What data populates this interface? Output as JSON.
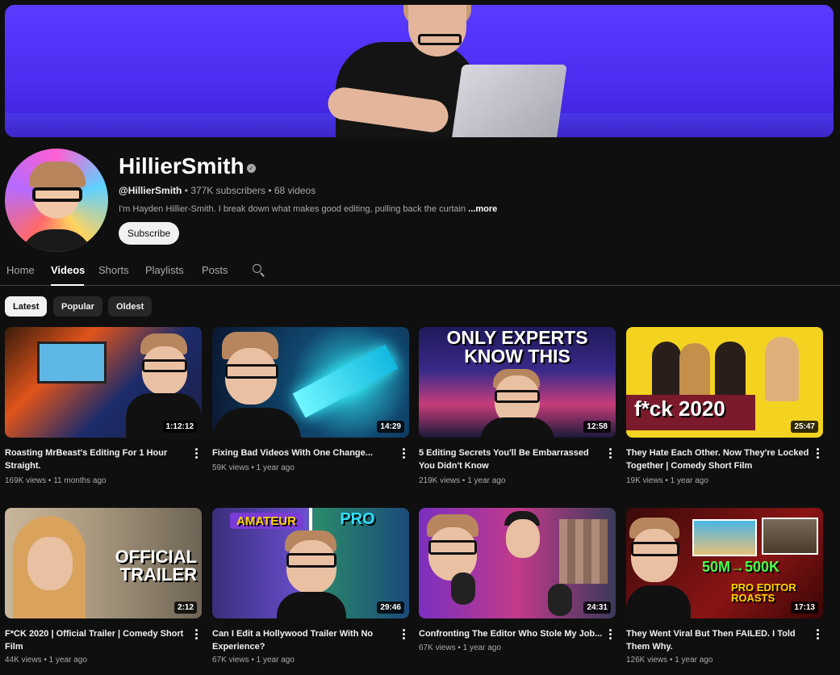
{
  "channel": {
    "name": "HillierSmith",
    "handle": "@HillierSmith",
    "subscribers": "377K subscribers",
    "videos": "68 videos",
    "description": "I'm Hayden Hillier-Smith. I break down what makes good editing, pulling back the curtain",
    "more_label": "...more",
    "subscribe_label": "Subscribe",
    "verified_mark": "✓"
  },
  "meta_separator": " • ",
  "tabs": [
    {
      "label": "Home"
    },
    {
      "label": "Videos"
    },
    {
      "label": "Shorts"
    },
    {
      "label": "Playlists"
    },
    {
      "label": "Posts"
    }
  ],
  "active_tab": "Videos",
  "chips": [
    {
      "label": "Latest"
    },
    {
      "label": "Popular"
    },
    {
      "label": "Oldest"
    }
  ],
  "videos": [
    {
      "title": "Roasting MrBeast's Editing For 1 Hour Straight.",
      "views": "169K views",
      "age": "11 months ago",
      "duration": "1:12:12"
    },
    {
      "title": "Fixing Bad Videos With One Change...",
      "views": "59K views",
      "age": "1 year ago",
      "duration": "14:29"
    },
    {
      "title": "5 Editing Secrets You'll Be Embarrassed You Didn't Know",
      "views": "219K views",
      "age": "1 year ago",
      "duration": "12:58",
      "thumb_text": "ONLY EXPERTS KNOW THIS"
    },
    {
      "title": "They Hate Each Other. Now They're Locked Together | Comedy Short Film",
      "views": "19K views",
      "age": "1 year ago",
      "duration": "25:47",
      "thumb_text": "f*ck 2020"
    },
    {
      "title": "F*CK 2020 | Official Trailer | Comedy Short Film",
      "views": "44K views",
      "age": "1 year ago",
      "duration": "2:12",
      "thumb_text": "OFFICIAL TRAILER"
    },
    {
      "title": "Can I Edit a Hollywood Trailer With No Experience?",
      "views": "67K views",
      "age": "1 year ago",
      "duration": "29:46",
      "thumb_text_left": "AMATEUR",
      "thumb_text_right": "PRO"
    },
    {
      "title": "Confronting The Editor Who Stole My Job...",
      "views": "67K views",
      "age": "1 year ago",
      "duration": "24:31"
    },
    {
      "title": "They Went Viral But Then FAILED. I Told Them Why.",
      "views": "126K views",
      "age": "1 year ago",
      "duration": "17:13",
      "thumb_text": "50M→500K",
      "thumb_text_2": "PRO EDITOR ROASTS"
    }
  ],
  "colors": {
    "background": "#0f0f0f",
    "banner": "#4b2df0",
    "text_primary": "#f1f1f1",
    "text_secondary": "#aaaaaa"
  }
}
